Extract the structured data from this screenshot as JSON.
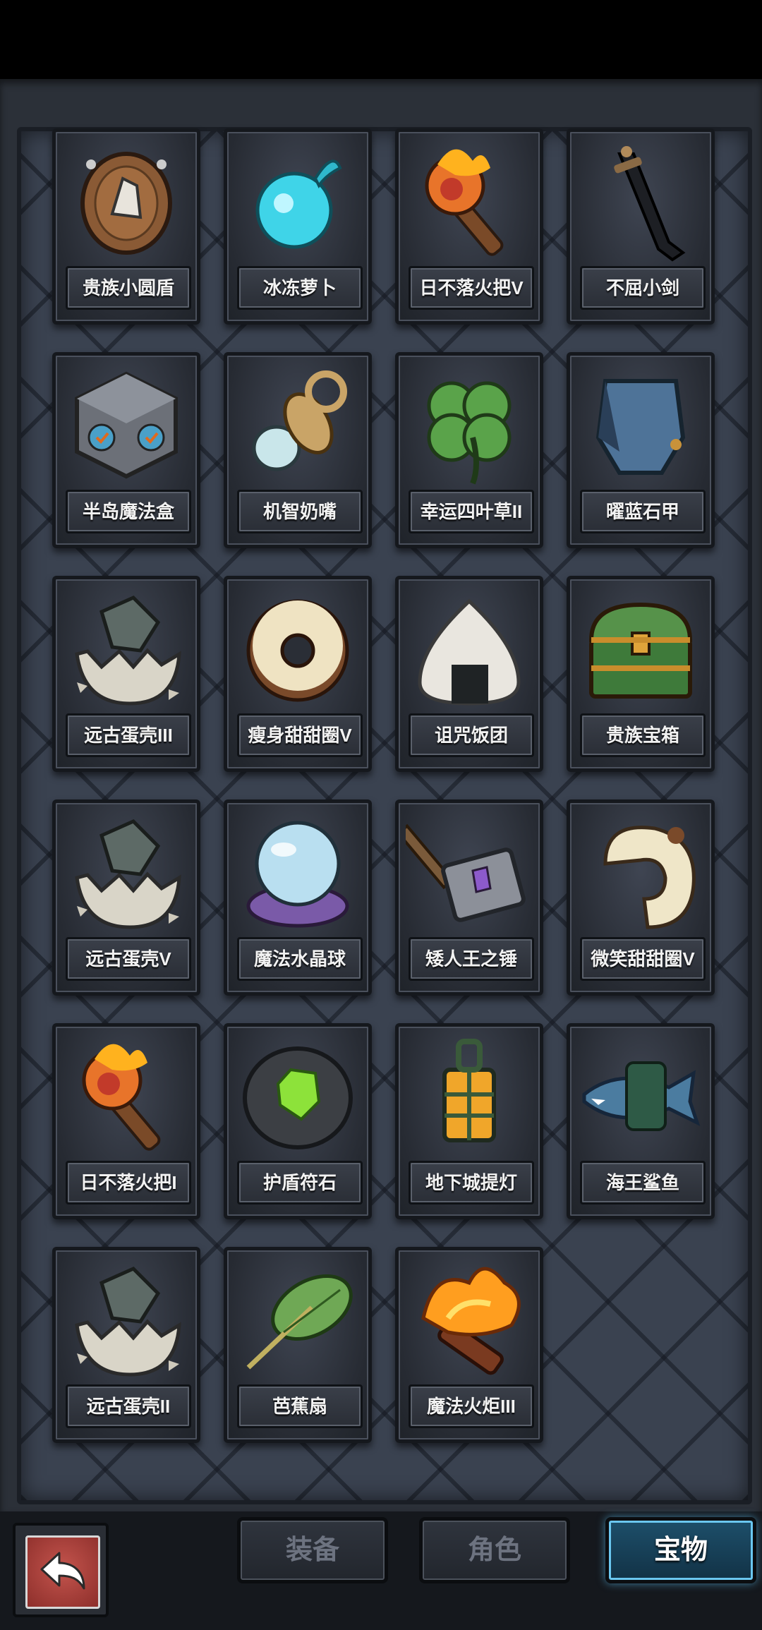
{
  "items": [
    {
      "name": "贵族小圆盾",
      "icon": "wooden-shield-icon"
    },
    {
      "name": "冰冻萝卜",
      "icon": "frozen-radish-icon"
    },
    {
      "name": "日不落火把V",
      "icon": "torch-icon"
    },
    {
      "name": "不屈小剑",
      "icon": "short-sword-icon"
    },
    {
      "name": "半岛魔法盒",
      "icon": "magic-cube-icon"
    },
    {
      "name": "机智奶嘴",
      "icon": "pacifier-icon"
    },
    {
      "name": "幸运四叶草II",
      "icon": "four-leaf-clover-icon"
    },
    {
      "name": "曜蓝石甲",
      "icon": "blue-armor-icon"
    },
    {
      "name": "远古蛋壳III",
      "icon": "broken-eggshell-icon"
    },
    {
      "name": "瘦身甜甜圈V",
      "icon": "donut-icon"
    },
    {
      "name": "诅咒饭团",
      "icon": "rice-ball-icon"
    },
    {
      "name": "贵族宝箱",
      "icon": "treasure-chest-icon"
    },
    {
      "name": "远古蛋壳V",
      "icon": "broken-eggshell-icon"
    },
    {
      "name": "魔法水晶球",
      "icon": "crystal-ball-icon"
    },
    {
      "name": "矮人王之锤",
      "icon": "war-hammer-icon"
    },
    {
      "name": "微笑甜甜圈V",
      "icon": "bitten-donut-icon"
    },
    {
      "name": "日不落火把I",
      "icon": "torch-icon"
    },
    {
      "name": "护盾符石",
      "icon": "rune-stone-icon"
    },
    {
      "name": "地下城提灯",
      "icon": "lantern-icon"
    },
    {
      "name": "海王鲨鱼",
      "icon": "shark-icon"
    },
    {
      "name": "远古蛋壳II",
      "icon": "broken-eggshell-icon"
    },
    {
      "name": "芭蕉扇",
      "icon": "leaf-fan-icon"
    },
    {
      "name": "魔法火炬III",
      "icon": "fire-torch-icon"
    }
  ],
  "tabs": [
    {
      "label": "装备",
      "active": false
    },
    {
      "label": "角色",
      "active": false
    },
    {
      "label": "宝物",
      "active": true
    }
  ],
  "back_icon": "back-arrow-icon"
}
